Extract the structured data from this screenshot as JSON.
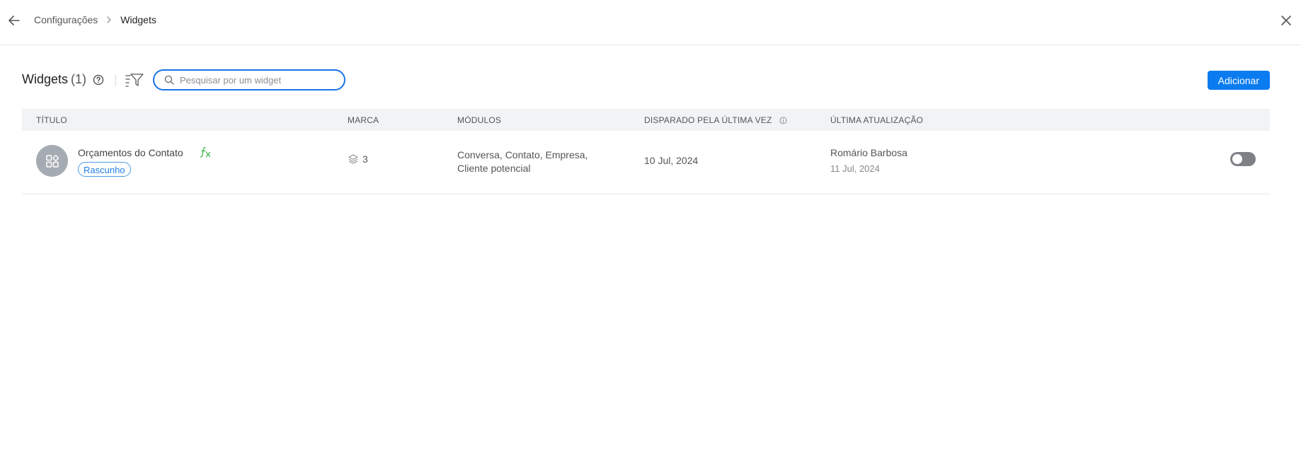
{
  "breadcrumb": {
    "parent": "Configurações",
    "current": "Widgets"
  },
  "header": {
    "title": "Widgets",
    "count": "(1)"
  },
  "search": {
    "placeholder": "Pesquisar por um widget",
    "value": ""
  },
  "actions": {
    "add_label": "Adicionar"
  },
  "table": {
    "columns": {
      "title": "TÍTULO",
      "brand": "MARCA",
      "modules": "MÓDULOS",
      "last_fired": "DISPARADO PELA ÚLTIMA VEZ",
      "last_update": "ÚLTIMA ATUALIZAÇÃO"
    },
    "rows": [
      {
        "name": "Orçamentos do Contato",
        "status": "Rascunho",
        "brand_count": "3",
        "modules_line1": "Conversa, Contato, Empresa,",
        "modules_line2": "Cliente potencial",
        "last_fired": "10 Jul, 2024",
        "updated_by": "Romário Barbosa",
        "updated_at": "11 Jul, 2024",
        "enabled": false
      }
    ]
  },
  "colors": {
    "accent": "#0b7cf0",
    "search_border": "#1a73e8",
    "fx_icon": "#3fb548",
    "toggle_off": "#7d8085",
    "avatar_bg": "#a5abb2"
  },
  "icons": {
    "back": "arrow-left-icon",
    "separator": "chevron-right-icon",
    "close": "close-icon",
    "help": "question-circle-icon",
    "filter": "filter-icon",
    "search": "search-icon",
    "widget": "widget-grid-icon",
    "function": "fx-icon",
    "brand": "layers-icon",
    "info": "info-icon"
  }
}
